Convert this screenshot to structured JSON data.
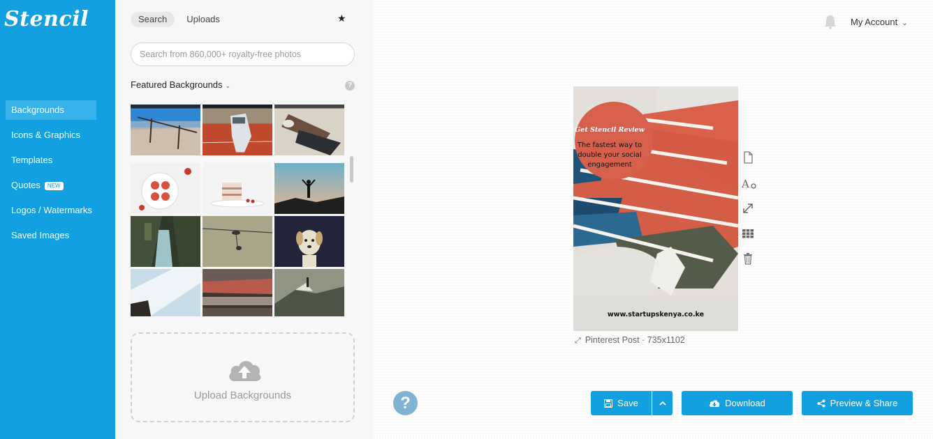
{
  "app": {
    "logo_text": "Stencil",
    "brand_color": "#12a0e0"
  },
  "sidebar": {
    "items": [
      {
        "label": "Backgrounds",
        "active": true
      },
      {
        "label": "Icons & Graphics"
      },
      {
        "label": "Templates"
      },
      {
        "label": "Quotes",
        "badge": "NEW"
      },
      {
        "label": "Logos / Watermarks"
      },
      {
        "label": "Saved Images"
      }
    ]
  },
  "panel": {
    "tabs": [
      {
        "label": "Search",
        "active": true
      },
      {
        "label": "Uploads"
      }
    ],
    "favorites_icon": "star-icon",
    "search": {
      "placeholder": "Search from 860,000+ royalty-free photos",
      "value": ""
    },
    "section_title": "Featured Backgrounds",
    "help_icon": "question-icon",
    "upload_label": "Upload Backgrounds"
  },
  "header": {
    "account_label": "My Account",
    "bell_icon": "bell-icon"
  },
  "design": {
    "title": "Get Stencil Review",
    "subtitle_lines": [
      "The fastest way to",
      "double your social",
      "engagement"
    ],
    "url": "www.startupskenya.co.ke",
    "size_label": "Pinterest Post · 735x1102"
  },
  "toolbar": {
    "tools": [
      "page-icon",
      "text-icon",
      "resize-icon",
      "grid-icon",
      "trash-icon"
    ]
  },
  "actions": {
    "save_label": "Save",
    "download_label": "Download",
    "share_label": "Preview & Share"
  }
}
